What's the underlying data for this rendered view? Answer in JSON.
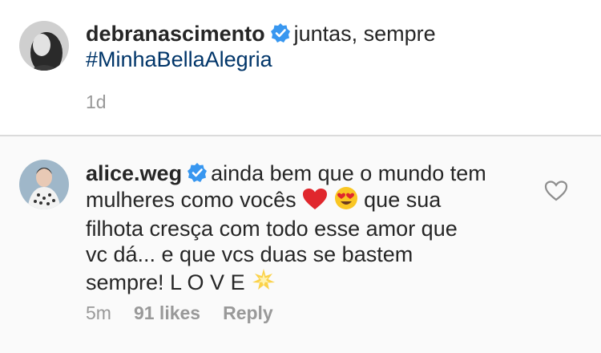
{
  "post": {
    "author": "debranascimento",
    "caption_text": "juntas, sempre",
    "hashtag": "#MinhaBellaAlegria",
    "timestamp": "1d"
  },
  "comment": {
    "author": "alice.weg",
    "line1": "ainda bem que o mundo tem",
    "line2_a": "mulheres como vocês",
    "line2_b": "que sua",
    "line3": "filhota cresça com todo esse amor que",
    "line4": "vc dá... e que vcs duas se bastem",
    "line5": "sempre! L O V E",
    "timestamp": "5m",
    "likes": "91 likes",
    "reply_label": "Reply"
  },
  "icons": {
    "verified": "verified-badge-icon",
    "like": "heart-outline-icon",
    "emoji_heart": "red-heart-emoji",
    "emoji_heart_eyes": "heart-eyes-emoji",
    "emoji_sparkle": "glowing-star-emoji"
  },
  "colors": {
    "verified_blue": "#3897f0",
    "hashtag": "#003569",
    "meta_gray": "#999999",
    "heart_red": "#e0272d"
  }
}
